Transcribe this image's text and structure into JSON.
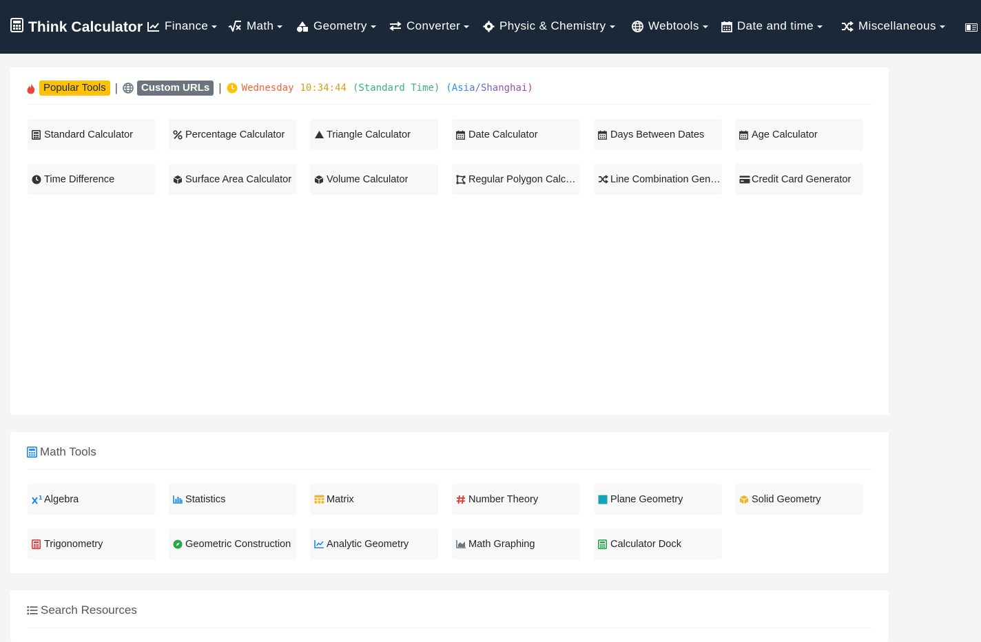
{
  "navbar": {
    "brand": "Think Calculator",
    "items": [
      {
        "label": "Finance"
      },
      {
        "label": "Math"
      },
      {
        "label": "Geometry"
      },
      {
        "label": "Converter"
      },
      {
        "label": "Physic & Chemistry"
      },
      {
        "label": "Webtools"
      },
      {
        "label": "Date and time"
      },
      {
        "label": "Miscellaneous"
      }
    ]
  },
  "popular": {
    "popular_label": "Popular Tools",
    "custom_label": "Custom URLs",
    "clock": {
      "day": "Wednesday",
      "time": "10:34:44",
      "zone": "(Standard Time)",
      "tz": "(Asia/Shanghai)"
    },
    "tools": [
      {
        "label": "Standard Calculator"
      },
      {
        "label": "Percentage Calculator"
      },
      {
        "label": "Triangle Calculator"
      },
      {
        "label": "Date Calculator"
      },
      {
        "label": "Days Between Dates"
      },
      {
        "label": "Age Calculator"
      },
      {
        "label": "Time Difference"
      },
      {
        "label": "Surface Area Calculator"
      },
      {
        "label": "Volume Calculator"
      },
      {
        "label": "Regular Polygon Calculator"
      },
      {
        "label": "Line Combination Generator"
      },
      {
        "label": "Credit Card Generator"
      }
    ]
  },
  "math_tools": {
    "title": "Math Tools",
    "tools": [
      {
        "label": "Algebra"
      },
      {
        "label": "Statistics"
      },
      {
        "label": "Matrix"
      },
      {
        "label": "Number Theory"
      },
      {
        "label": "Plane Geometry"
      },
      {
        "label": "Solid Geometry"
      },
      {
        "label": "Trigonometry"
      },
      {
        "label": "Geometric Construction"
      },
      {
        "label": "Analytic Geometry"
      },
      {
        "label": "Math Graphing"
      },
      {
        "label": "Calculator Dock"
      }
    ]
  },
  "search": {
    "title": "Search Resources"
  },
  "colors": {
    "navbar_bg": "#1b2838",
    "badge_warning": "#ffc107",
    "badge_secondary": "#6c757d",
    "clock_day": "#f0643c",
    "clock_time": "#d4a017",
    "clock_zone": "#3cb371",
    "clock_tz": "#1e90ff"
  }
}
